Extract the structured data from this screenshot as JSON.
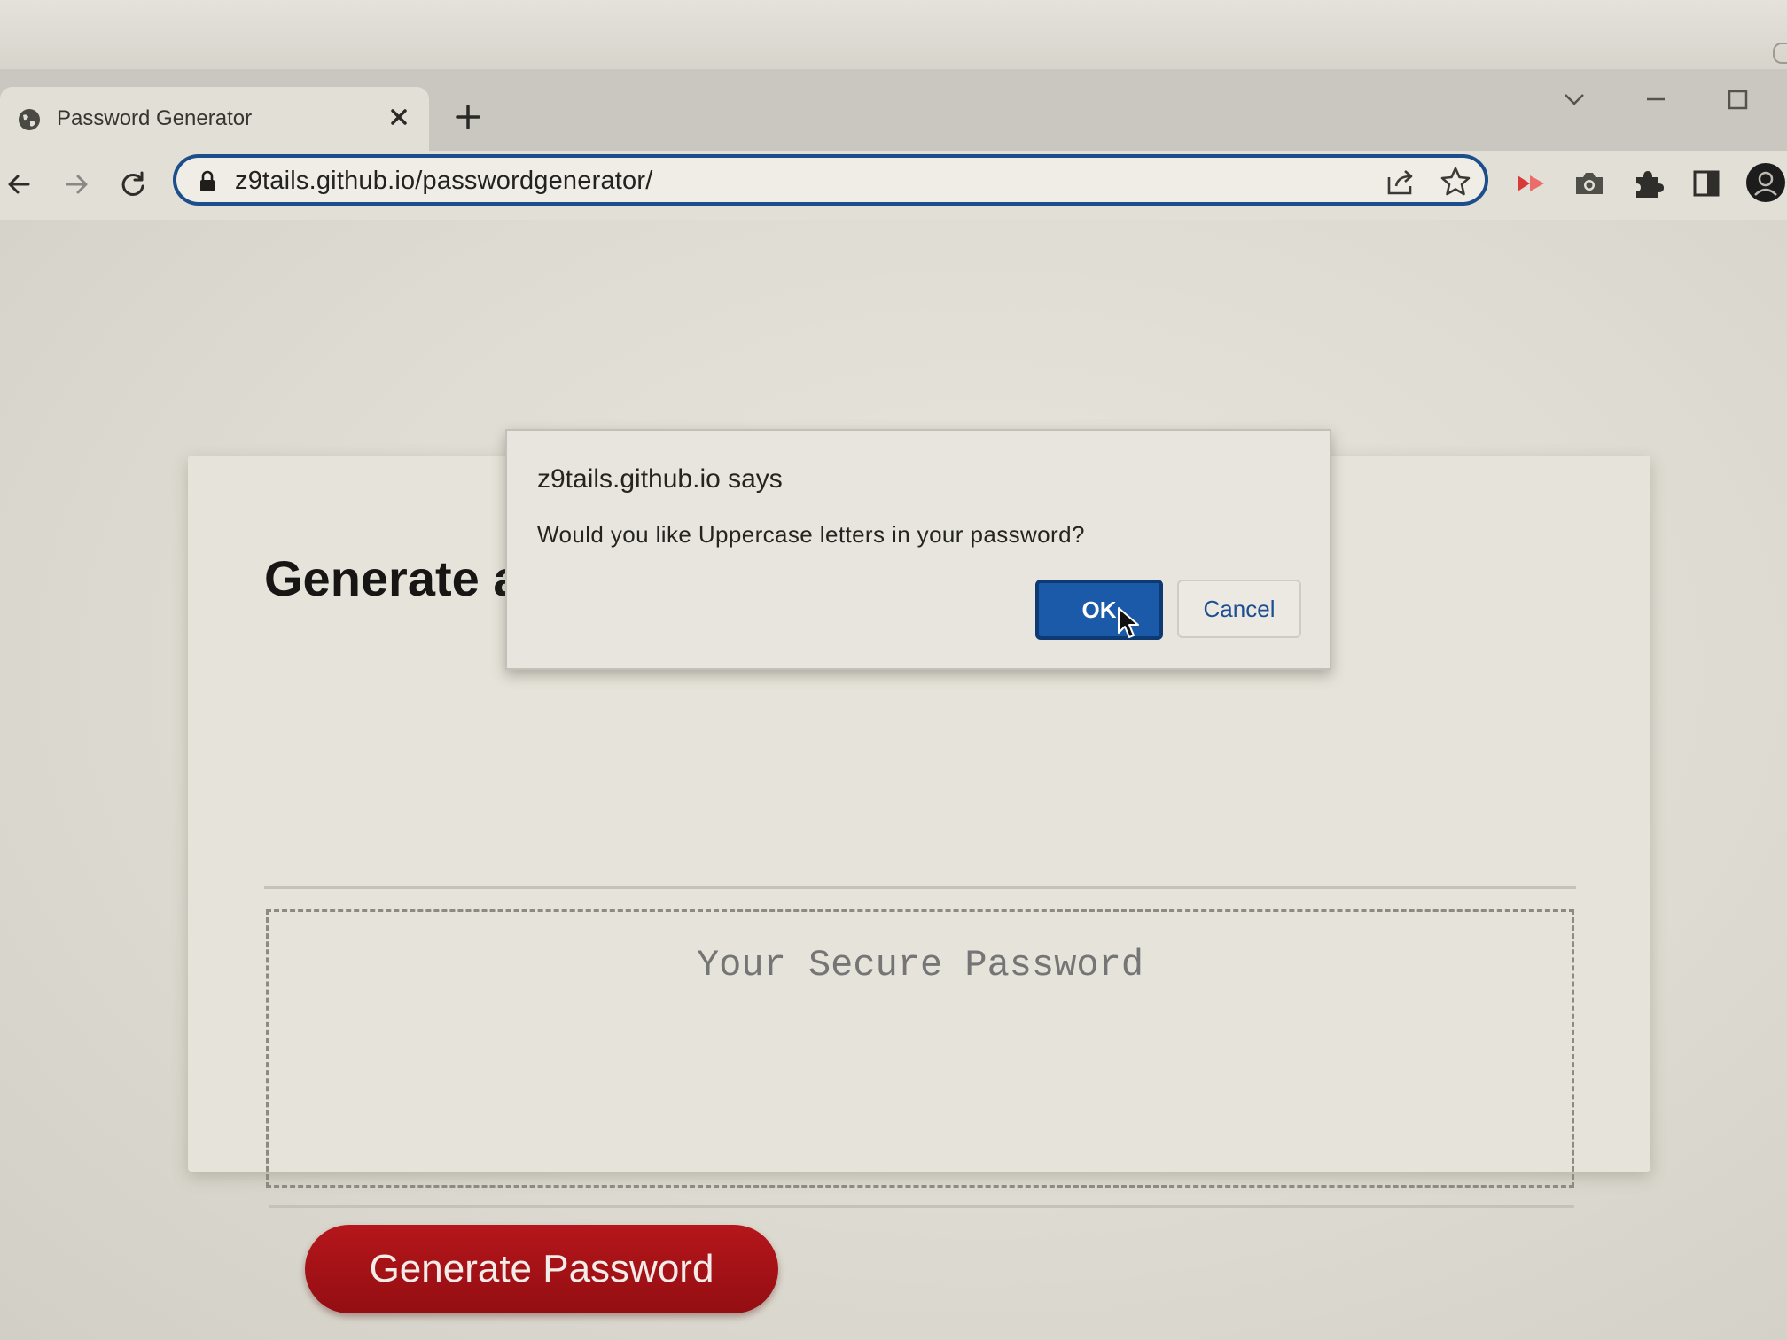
{
  "browser": {
    "tab": {
      "title": "Password Generator",
      "favicon": "globe-icon",
      "close_icon": "close-icon"
    },
    "new_tab_icon": "plus-icon",
    "window_controls": [
      "chevron-down-icon",
      "minimize-icon",
      "maximize-icon"
    ],
    "nav": [
      "back-arrow-icon",
      "forward-arrow-icon",
      "reload-icon"
    ],
    "address_bar": {
      "url": "z9tails.github.io/passwordgenerator/",
      "lock_icon": "lock-icon",
      "right_icons": [
        "share-icon",
        "bookmark-star-icon"
      ]
    },
    "extensions": [
      "red-extension-icon",
      "camera-icon",
      "puzzle-icon",
      "side-panel-icon",
      "profile-avatar-icon"
    ],
    "focus_color": "#1c4e8c"
  },
  "dialog": {
    "title": "z9tails.github.io says",
    "message": "Would you like Uppercase letters in your password?",
    "ok_label": "OK",
    "cancel_label": "Cancel",
    "ok_color": "#1a5aa8"
  },
  "page": {
    "heading": "Generate a Password",
    "password_placeholder": "Your Secure Password",
    "generate_label": "Generate Password",
    "button_color": "#a31216"
  }
}
